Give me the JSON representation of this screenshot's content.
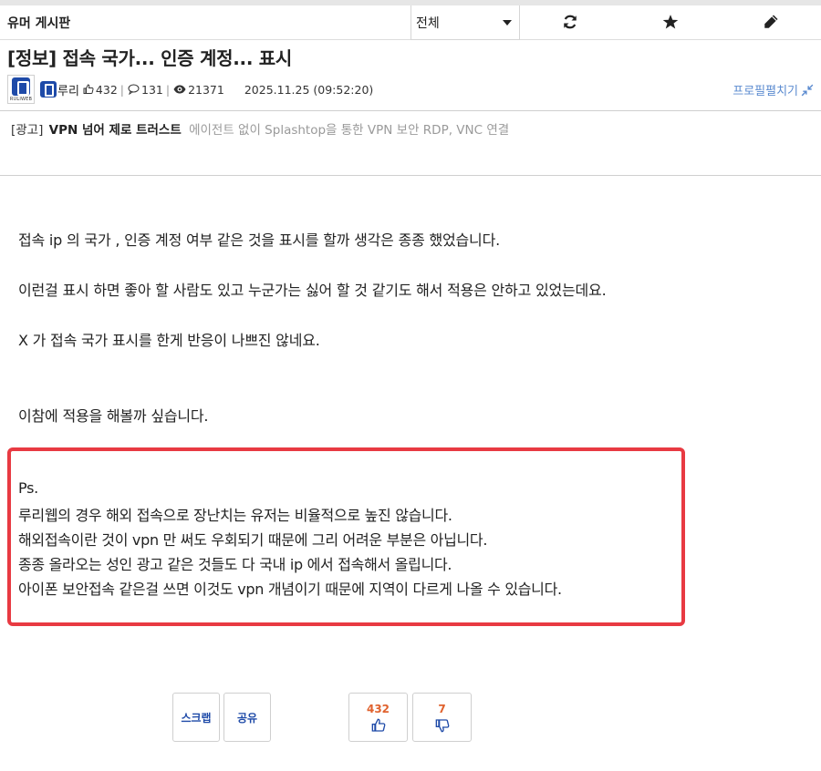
{
  "board": {
    "name": "유머 게시판",
    "category": "전체"
  },
  "toolbar_icons": {
    "refresh": "refresh-icon",
    "favorite": "star-icon",
    "write": "pencil-icon"
  },
  "post": {
    "title": "[정보] 접속 국가... 인증 계정... 표시",
    "author": "루리",
    "likes": "432",
    "comments": "131",
    "views": "21371",
    "datetime": "2025.11.25 (09:52:20)",
    "avatar_brand": "RULIWEB",
    "profile_toggle": "프로필펼치기"
  },
  "ad": {
    "tag": "[광고]",
    "title": "VPN 넘어 제로 트러스트",
    "desc": "에이전트 없이 Splashtop을 통한 VPN 보안 RDP, VNC 연결"
  },
  "body": {
    "p1": "접속 ip 의 국가 , 인증 계정 여부 같은 것을 표시를 할까 생각은 종종 했었습니다.",
    "p2": "이런걸 표시 하면 좋아 할 사람도 있고 누군가는 싫어 할 것 같기도 해서 적용은 안하고 있었는데요.",
    "p3": "X 가 접속 국가 표시를 한게 반응이 나쁘진 않네요.",
    "p4": "이참에 적용을 해볼까 싶습니다."
  },
  "ps": {
    "heading": "Ps.",
    "lines": [
      "루리웹의 경우 해외 접속으로 장난치는 유저는 비율적으로 높진 않습니다.",
      "해외접속이란 것이 vpn 만 써도 우회되기 때문에 그리 어려운 부분은 아닙니다.",
      "종종 올라오는 성인 광고 같은 것들도 다 국내 ip 에서 접속해서 올립니다.",
      "아이폰 보안접속 같은걸 쓰면 이것도 vpn 개념이기 때문에 지역이 다르게 나올 수 있습니다."
    ]
  },
  "actions": {
    "scrap": "스크랩",
    "share": "공유",
    "upvotes": "432",
    "downvotes": "7"
  },
  "colors": {
    "accent": "#1e4aa8",
    "highlight_border": "#e83a42",
    "vote_count": "#e0622e",
    "profile_link": "#5b8bd0"
  }
}
